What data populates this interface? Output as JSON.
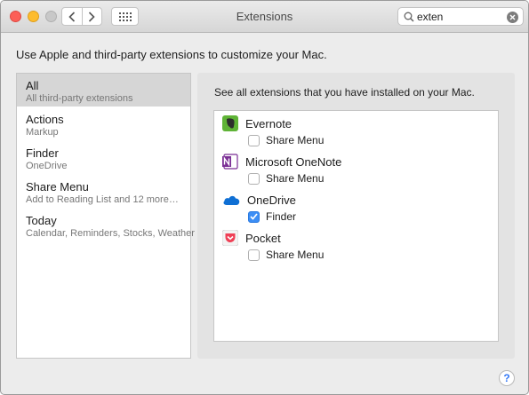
{
  "window": {
    "title": "Extensions"
  },
  "search": {
    "value": "exten"
  },
  "header": {
    "description": "Use Apple and third-party extensions to customize your Mac."
  },
  "sidebar": {
    "items": [
      {
        "label": "All",
        "sub": "All third-party extensions",
        "selected": true
      },
      {
        "label": "Actions",
        "sub": "Markup"
      },
      {
        "label": "Finder",
        "sub": "OneDrive"
      },
      {
        "label": "Share Menu",
        "sub": "Add to Reading List and 12 more…"
      },
      {
        "label": "Today",
        "sub": "Calendar, Reminders, Stocks, Weather"
      }
    ]
  },
  "main": {
    "title": "See all extensions that you have installed on your Mac.",
    "apps": [
      {
        "name": "Evernote",
        "icon": "evernote-icon",
        "color": "#5fb336",
        "extension": {
          "label": "Share Menu",
          "checked": false
        }
      },
      {
        "name": "Microsoft OneNote",
        "icon": "onenote-icon",
        "color": "#7b2f95",
        "extension": {
          "label": "Share Menu",
          "checked": false
        }
      },
      {
        "name": "OneDrive",
        "icon": "onedrive-icon",
        "color": "#0f6fd4",
        "extension": {
          "label": "Finder",
          "checked": true
        }
      },
      {
        "name": "Pocket",
        "icon": "pocket-icon",
        "color": "#ef4056",
        "extension": {
          "label": "Share Menu",
          "checked": false
        }
      }
    ]
  },
  "help": {
    "label": "?"
  }
}
